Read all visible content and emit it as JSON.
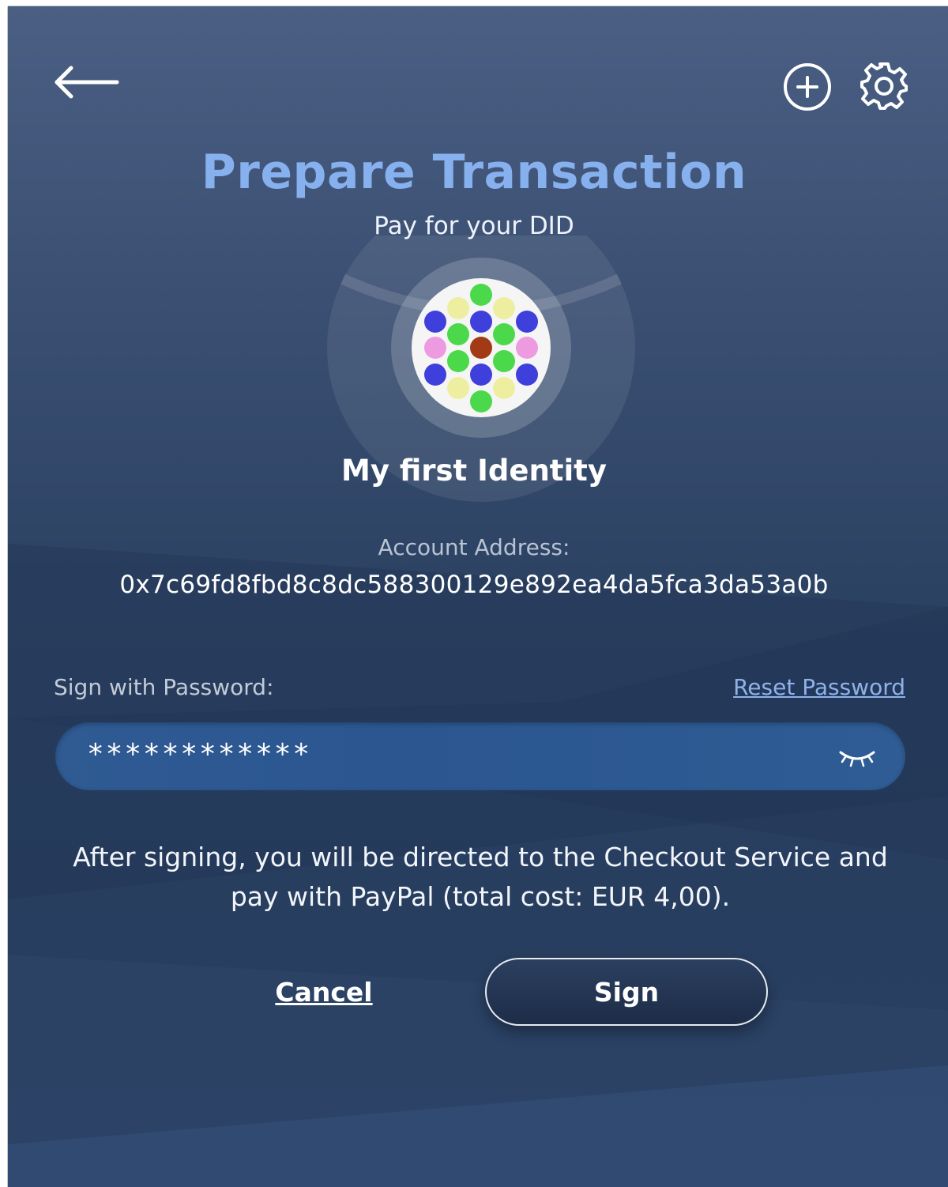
{
  "header": {
    "back_icon": "arrow-left-icon",
    "add_icon": "plus-circle-icon",
    "settings_icon": "gear-icon"
  },
  "page": {
    "title": "Prepare Transaction",
    "subtitle": "Pay for your DID"
  },
  "identity": {
    "name": "My first Identity",
    "avatar_icon": "identicon-dots",
    "avatar_colors": [
      "#3f3fdb",
      "#4bd94b",
      "#eeeea0",
      "#ee9ae0",
      "#a33a16"
    ]
  },
  "account": {
    "label": "Account Address:",
    "address": "0x7c69fd8fbd8c8dc588300129e892ea4da5fca3da53a0b"
  },
  "password": {
    "label": "Sign with Password:",
    "reset_label": "Reset Password",
    "value": "************",
    "toggle_icon": "eye-closed-icon"
  },
  "notice": {
    "text": "After signing, you will be directed to the Checkout Service and pay with PayPal (total cost: EUR 4,00)."
  },
  "actions": {
    "cancel_label": "Cancel",
    "sign_label": "Sign"
  },
  "colors": {
    "title": "#86b0ee",
    "link": "#8fb2ea",
    "field_bg": "#2f5a92",
    "background_top": "#4a5f83",
    "background_bottom": "#283e5f"
  }
}
